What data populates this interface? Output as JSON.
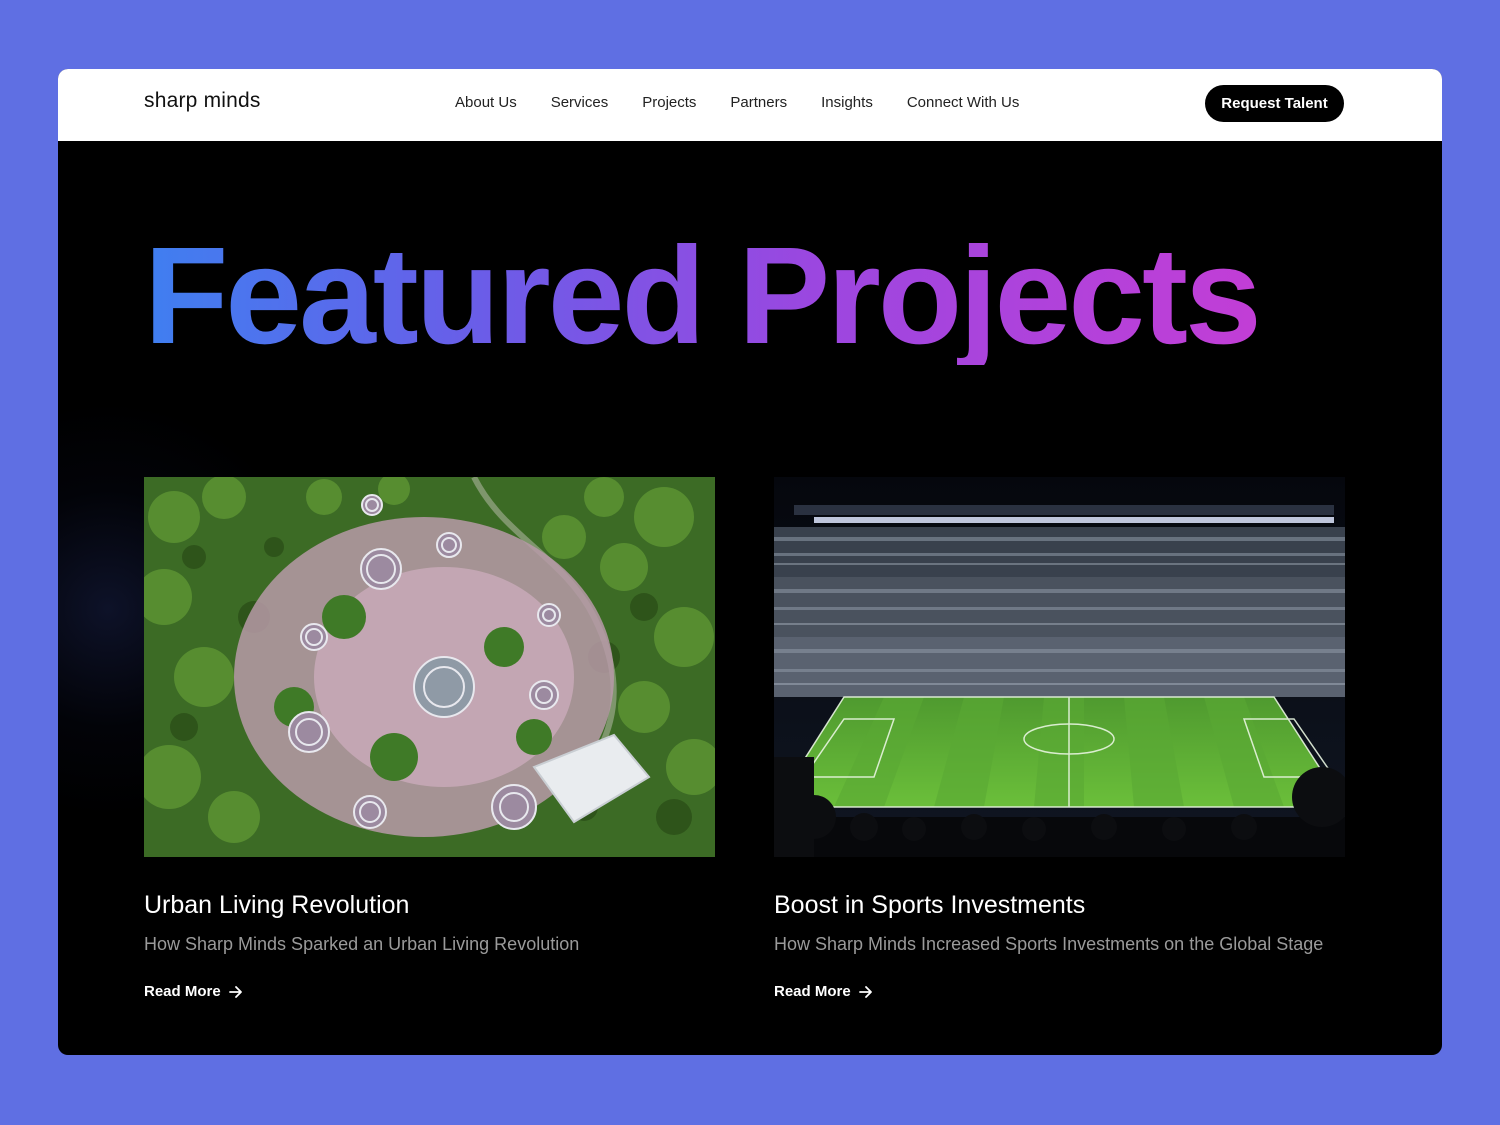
{
  "brand": "sharp minds",
  "nav": {
    "items": [
      "About Us",
      "Services",
      "Projects",
      "Partners",
      "Insights",
      "Connect With Us"
    ]
  },
  "cta_label": "Request Talent",
  "hero": {
    "title": "Featured Projects"
  },
  "projects": [
    {
      "title": "Urban Living Revolution",
      "subtitle": "How Sharp Minds Sparked an Urban Living Revolution",
      "link_label": "Read More",
      "image": "aerial-garden-photo"
    },
    {
      "title": "Boost in Sports Investments",
      "subtitle": "How Sharp Minds Increased Sports Investments on the Global Stage",
      "link_label": "Read More",
      "image": "stadium-photo"
    }
  ],
  "colors": {
    "background": "#5f6fe3",
    "gradient_start": "#3f7ff0",
    "gradient_end": "#c23ed6"
  }
}
